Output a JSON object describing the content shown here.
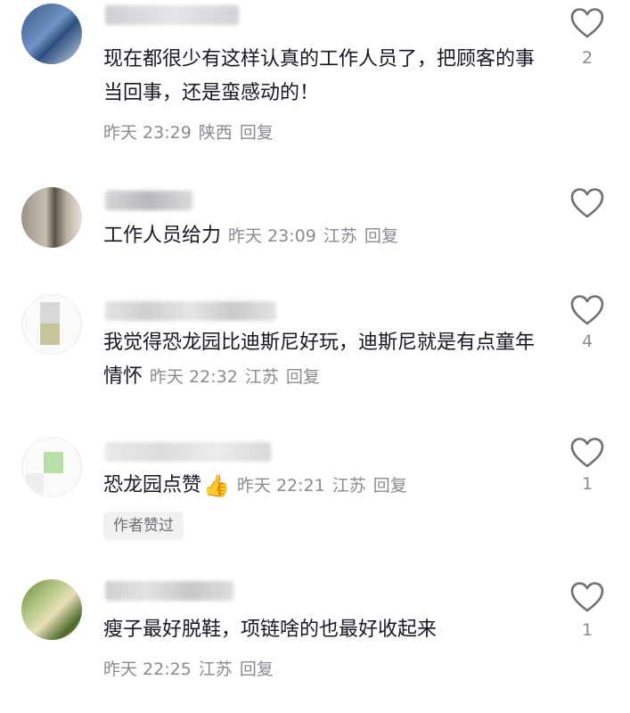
{
  "comments": [
    {
      "text": "现在都很少有这样认真的工作人员了，把顾客的事当回事，还是蛮感动的！",
      "date": "昨天 23:29",
      "location": "陕西",
      "reply": "回复",
      "likes": "2"
    },
    {
      "text": "工作人员给力",
      "date": "昨天 23:09",
      "location": "江苏",
      "reply": "回复",
      "likes": ""
    },
    {
      "text": "我觉得恐龙园比迪斯尼好玩，迪斯尼就是有点童年情怀",
      "date": "昨天 22:32",
      "location": "江苏",
      "reply": "回复",
      "likes": "4"
    },
    {
      "text": "恐龙园点赞",
      "emoji": "👍",
      "date": "昨天 22:21",
      "location": "江苏",
      "reply": "回复",
      "likes": "1",
      "author_tag": "作者赞过"
    },
    {
      "text": "瘦子最好脱鞋，项链啥的也最好收起来",
      "date": "昨天 22:25",
      "location": "江苏",
      "reply": "回复",
      "likes": "1"
    }
  ],
  "icons": {
    "like": "heart-outline-icon"
  },
  "colors": {
    "text": "#161823",
    "meta": "#8a8b91",
    "tag_bg": "#f1f1f2"
  }
}
